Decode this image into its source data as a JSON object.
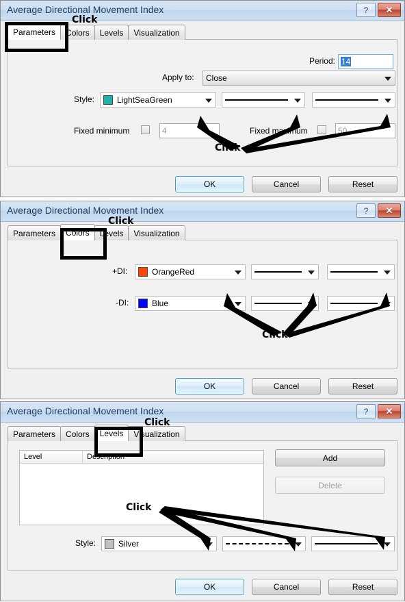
{
  "window": {
    "title": "Average Directional Movement Index",
    "help_button": "?",
    "close_button": "✕"
  },
  "tabs": [
    "Parameters",
    "Colors",
    "Levels",
    "Visualization"
  ],
  "buttons": {
    "ok": "OK",
    "cancel": "Cancel",
    "reset": "Reset"
  },
  "annotation_label": "Click",
  "dialog1": {
    "active_tab": "Parameters",
    "period": {
      "label": "Period:",
      "value": "14"
    },
    "apply_to": {
      "label": "Apply to:",
      "value": "Close"
    },
    "style": {
      "label": "Style:",
      "color_name": "LightSeaGreen",
      "color_hex": "#20b2aa"
    },
    "fixed_minimum": {
      "label": "Fixed minimum",
      "value": "4",
      "checked": false
    },
    "fixed_maximum": {
      "label": "Fixed maximum",
      "value": "50",
      "checked": false
    }
  },
  "dialog2": {
    "active_tab": "Colors",
    "plus_di": {
      "label": "+DI:",
      "color_name": "OrangeRed",
      "color_hex": "#ff4500"
    },
    "minus_di": {
      "label": "-DI:",
      "color_name": "Blue",
      "color_hex": "#0000ff"
    }
  },
  "dialog3": {
    "active_tab": "Levels",
    "table": {
      "columns": [
        "Level",
        "Description"
      ],
      "rows": []
    },
    "add_button": "Add",
    "delete_button": "Delete",
    "style": {
      "label": "Style:",
      "color_name": "Silver",
      "color_hex": "#c0c0c0"
    }
  }
}
